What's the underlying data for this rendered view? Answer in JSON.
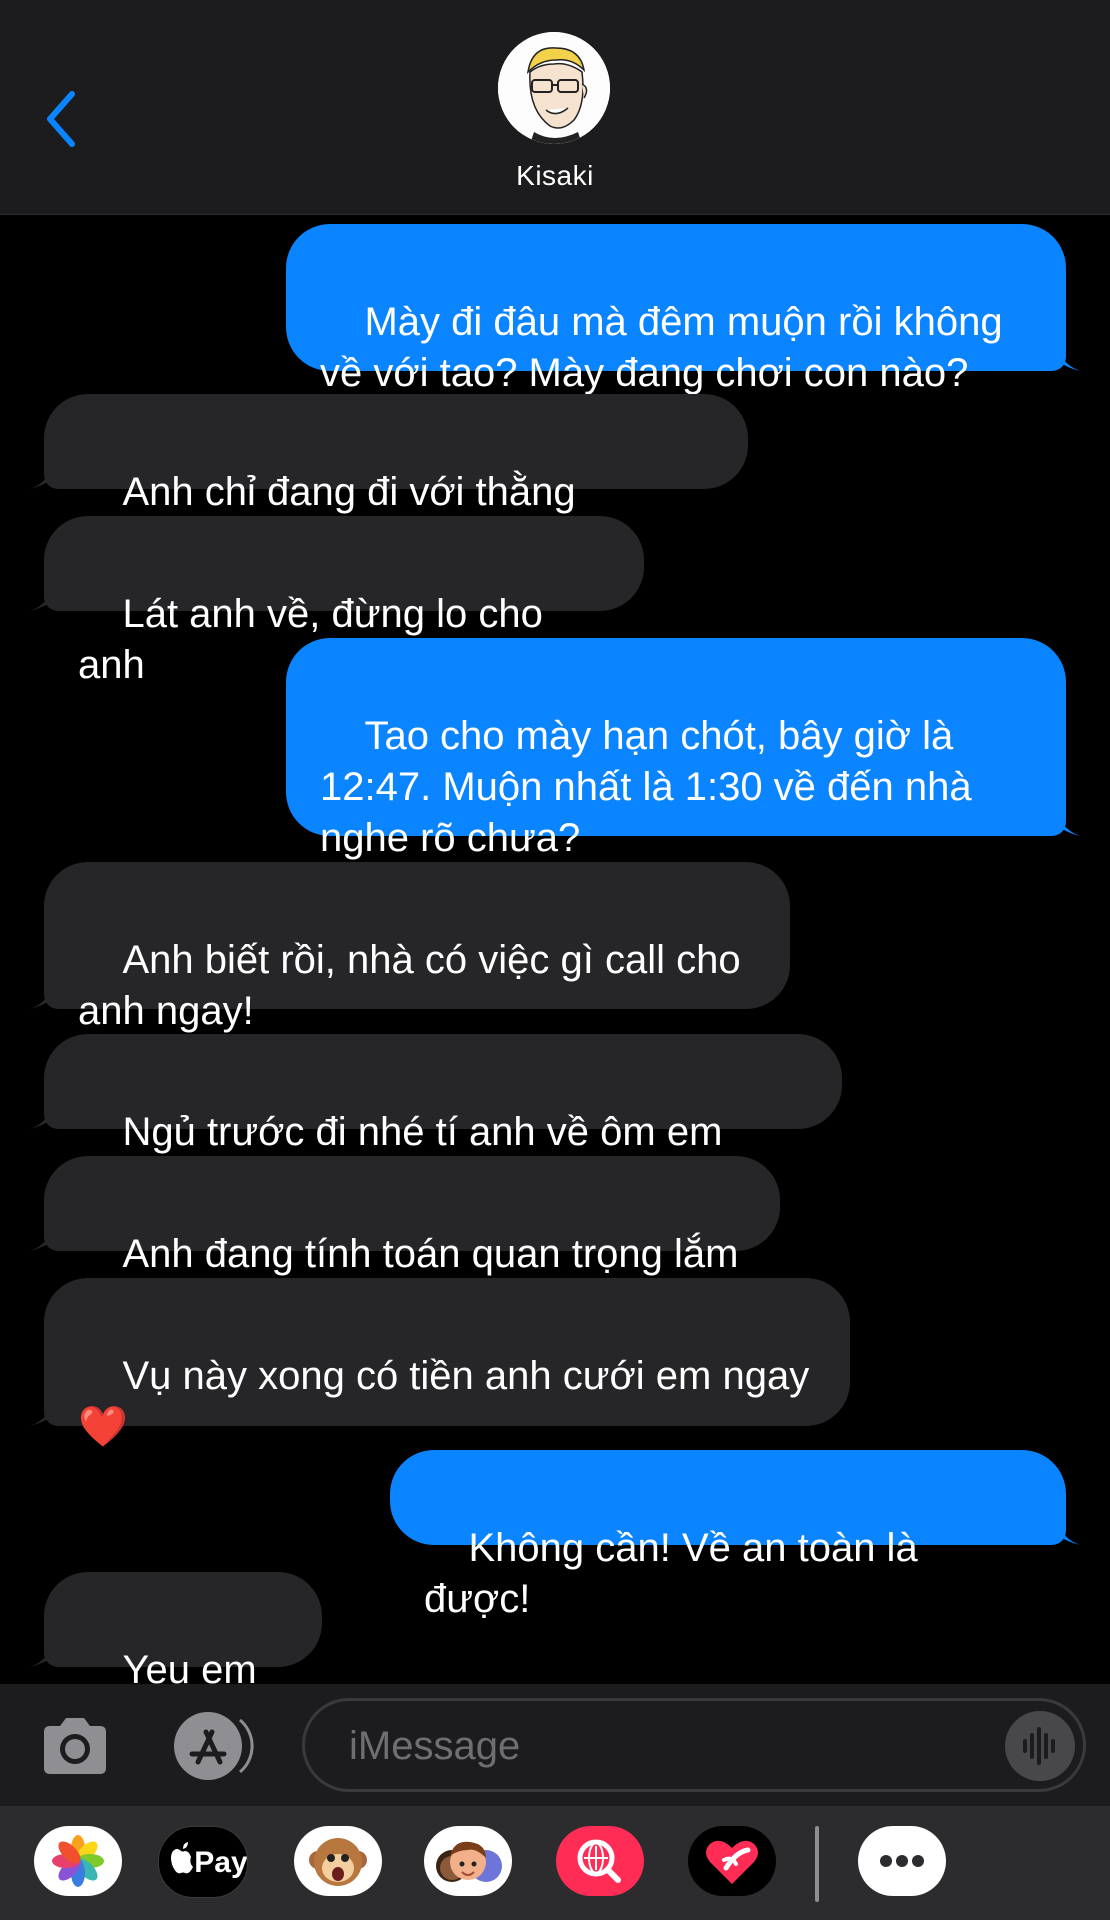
{
  "header": {
    "contact_name": "Kisaki"
  },
  "messages": [
    {
      "from": "me",
      "text": "Mày đi đâu mà đêm muộn rồi không\nvề với tao? Mày đang chơi con nào?"
    },
    {
      "from": "them",
      "text": "Anh chỉ đang đi với thằng Hanma"
    },
    {
      "from": "them",
      "text": "Lát anh về, đừng lo cho anh"
    },
    {
      "from": "me",
      "text": "Tao cho mày hạn chót, bây giờ là\n12:47. Muộn nhất là 1:30 về đến nhà\nnghe rõ chưa?"
    },
    {
      "from": "them",
      "text": "Anh biết rồi, nhà có việc gì call cho\nanh ngay!"
    },
    {
      "from": "them",
      "text": "Ngủ trước đi nhé tí anh về ôm em sau."
    },
    {
      "from": "them",
      "text": "Anh đang tính toán quan trọng lắm"
    },
    {
      "from": "them",
      "text": "Vụ này xong có tiền anh cưới em ngay\n",
      "emoji": "❤️"
    },
    {
      "from": "me",
      "text": "Không cần! Về an toàn là được!"
    },
    {
      "from": "them",
      "text": "Yeu em ",
      "emoji": "❤️"
    }
  ],
  "compose": {
    "placeholder": "iMessage"
  },
  "app_drawer": {
    "apple_pay_label": "Pay",
    "apps": [
      "photos-icon",
      "apple-pay-icon",
      "monkey-memoji-icon",
      "memoji-icon",
      "image-search-icon",
      "digital-touch-icon",
      "more-icon"
    ]
  },
  "colors": {
    "sent_bubble": "#0a84ff",
    "received_bubble": "#262628",
    "accent": "#0a84ff",
    "background": "#000000"
  }
}
